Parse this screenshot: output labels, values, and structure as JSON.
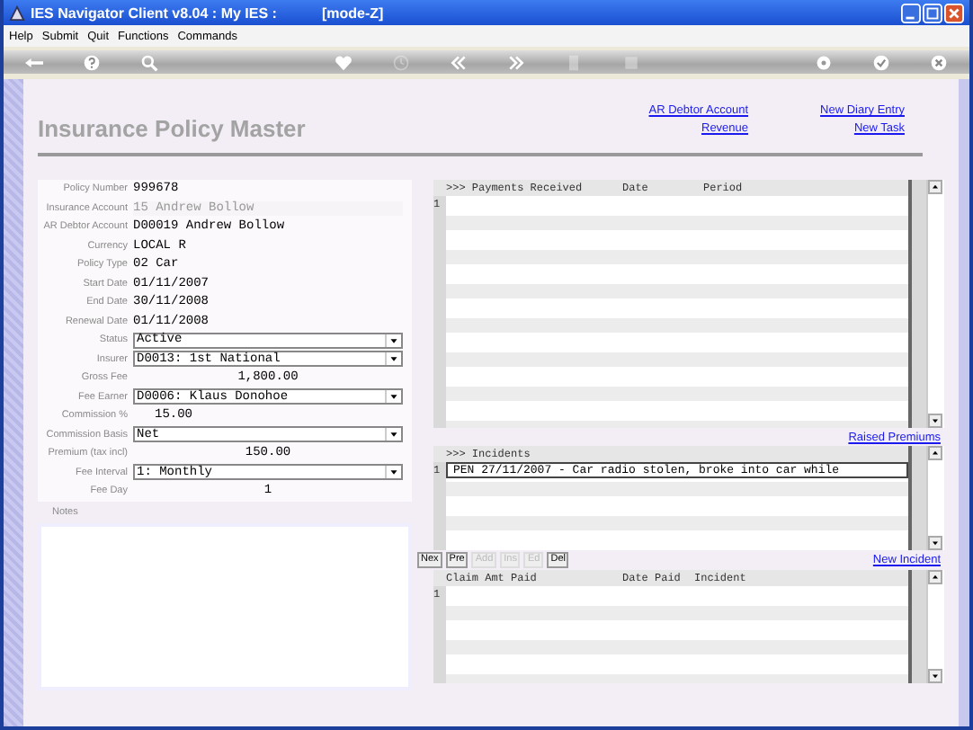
{
  "window": {
    "title": "IES Navigator Client v8.04 : My IES :",
    "mode": "[mode-Z]"
  },
  "menu": [
    "Help",
    "Submit",
    "Quit",
    "Functions",
    "Commands"
  ],
  "toolbar": [
    {
      "kind": "back",
      "disabled": false
    },
    {
      "kind": "help",
      "disabled": false
    },
    {
      "kind": "search",
      "disabled": false
    },
    {
      "kind": "heart",
      "disabled": false
    },
    {
      "kind": "clock",
      "disabled": true
    },
    {
      "kind": "rewind",
      "disabled": false
    },
    {
      "kind": "forward",
      "disabled": false
    },
    {
      "kind": "page",
      "disabled": true
    },
    {
      "kind": "square",
      "disabled": true
    },
    {
      "kind": "gear",
      "disabled": false
    },
    {
      "kind": "check",
      "disabled": false
    },
    {
      "kind": "close",
      "disabled": false
    }
  ],
  "page": {
    "title": "Insurance Policy Master",
    "links_left": [
      "AR Debtor Account",
      "Revenue"
    ],
    "links_right": [
      "New Diary Entry",
      "New Task"
    ]
  },
  "fields": [
    {
      "label": "Policy Number",
      "value": "999678",
      "kind": "text"
    },
    {
      "label": "Insurance Account",
      "value": "15 Andrew Bollow",
      "kind": "readonly"
    },
    {
      "label": "AR Debtor Account",
      "value": "D00019 Andrew Bollow",
      "kind": "text"
    },
    {
      "label": "Currency",
      "value": "LOCAL R",
      "kind": "text"
    },
    {
      "label": "Policy Type",
      "value": "02 Car",
      "kind": "text"
    },
    {
      "label": "Start Date",
      "value": "01/11/2007",
      "kind": "text"
    },
    {
      "label": "End Date",
      "value": "30/11/2008",
      "kind": "text"
    },
    {
      "label": "Renewal Date",
      "value": "01/11/2008",
      "kind": "text"
    },
    {
      "label": "Status",
      "value": "Active",
      "kind": "select"
    },
    {
      "label": "Insurer",
      "value": "D0013: 1st National",
      "kind": "select"
    },
    {
      "label": "Gross Fee",
      "value": "1,800.00",
      "kind": "amount"
    },
    {
      "label": "Fee Earner",
      "value": "D0006: Klaus Donohoe",
      "kind": "select"
    },
    {
      "label": "Commission %",
      "value": "15.00",
      "kind": "number"
    },
    {
      "label": "Commission Basis",
      "value": "Net",
      "kind": "select"
    },
    {
      "label": "Premium (tax incl)",
      "value": "150.00",
      "kind": "amount"
    },
    {
      "label": "Fee Interval",
      "value": "1: Monthly",
      "kind": "select"
    },
    {
      "label": "Fee Day",
      "value": "1",
      "kind": "amount"
    }
  ],
  "notes": {
    "label": "Notes"
  },
  "payments": {
    "columns": [
      ">>> Payments Received",
      "Date",
      "Period"
    ],
    "rows": [
      {
        "number": "1"
      }
    ]
  },
  "raised_premiums_link": "Raised Premiums",
  "incidents": {
    "columns": [
      ">>> Incidents"
    ],
    "rows": [
      {
        "number": "1",
        "text": "PEN 27/11/2007 - Car radio stolen, broke into car while",
        "selected": true
      }
    ]
  },
  "incident_buttons": [
    {
      "label": "Nex",
      "disabled": false
    },
    {
      "label": "Pre",
      "disabled": false
    },
    {
      "label": "Add",
      "disabled": true
    },
    {
      "label": "Ins",
      "disabled": true
    },
    {
      "label": "Ed",
      "disabled": true
    },
    {
      "label": "Del",
      "disabled": false
    }
  ],
  "new_incident_link": "New Incident",
  "claims": {
    "columns": [
      "Claim Amt Paid",
      "Date Paid",
      "Incident"
    ],
    "rows": [
      {
        "number": "1"
      }
    ]
  }
}
